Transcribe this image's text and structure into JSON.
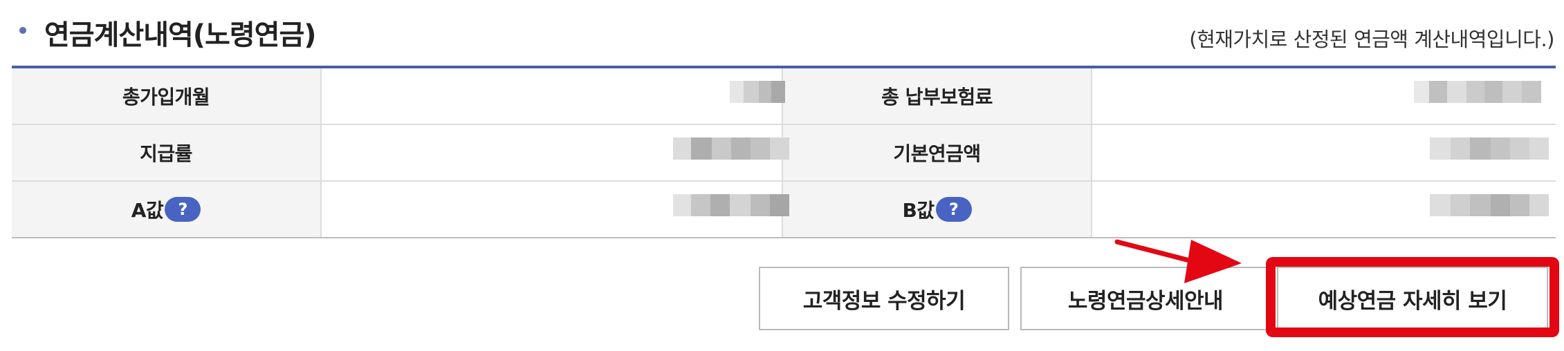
{
  "section": {
    "title": "연금계산내역(노령연금)",
    "note": "(현재가치로 산정된 연금액 계산내역입니다.)"
  },
  "table": {
    "rows": [
      {
        "left_label": "총가입개월",
        "right_label": "총 납부보험료"
      },
      {
        "left_label": "지급률",
        "right_label": "기본연금액"
      },
      {
        "left_label": "A값",
        "right_label": "B값"
      }
    ],
    "help_icon": "?"
  },
  "buttons": {
    "edit": "고객정보 수정하기",
    "guide": "노령연금상세안내",
    "detail": "예상연금 자세히 보기"
  },
  "colors": {
    "accent": "#4a5dab",
    "help_badge": "#4863c2",
    "highlight": "#e30613"
  },
  "icons": {
    "help": "question-badge-icon",
    "bullet": "bullet-dot-icon",
    "annotation": "red-arrow-icon"
  }
}
